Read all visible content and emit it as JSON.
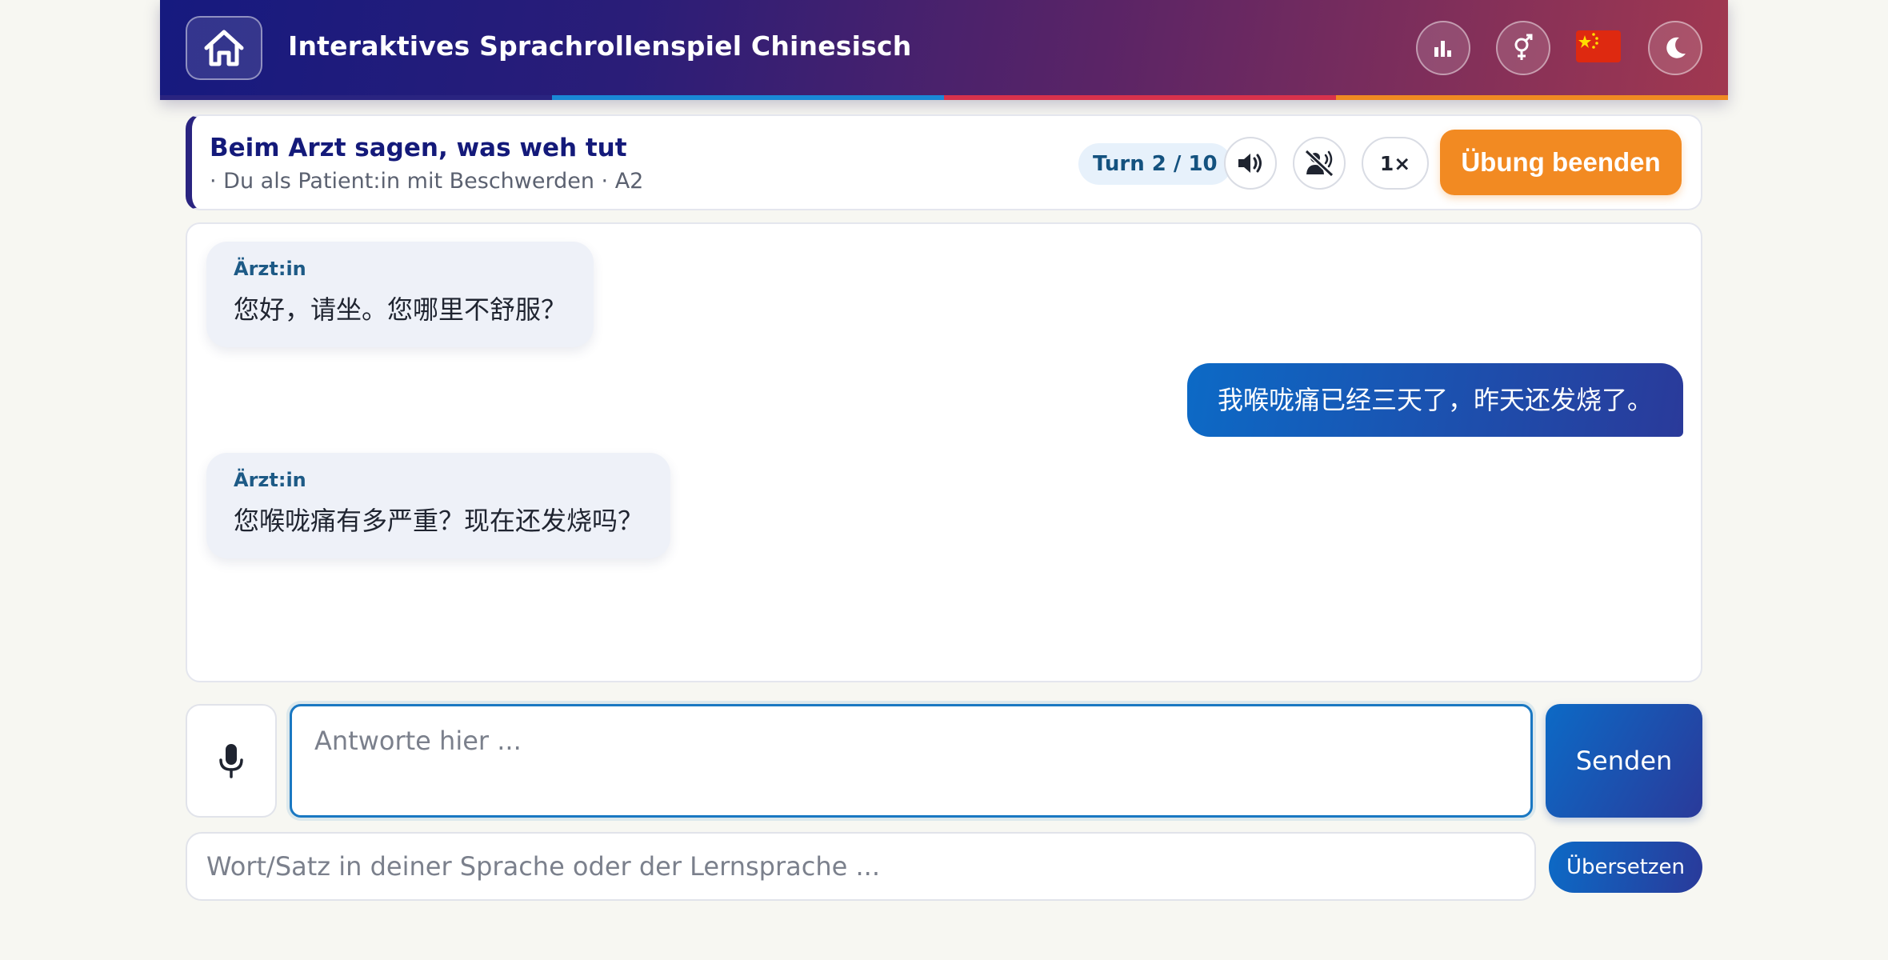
{
  "header": {
    "title": "Interaktives Sprachrollenspiel Chinesisch",
    "strip_colors": [
      "#2a2480",
      "#1a88d6",
      "#d8324c",
      "#f08a22"
    ]
  },
  "scenario": {
    "title": "Beim Arzt sagen, was weh tut",
    "subtitle": "· Du als Patient:in mit Beschwerden · A2",
    "turn": "Turn 2 / 10",
    "speed": "1×",
    "end_label": "Übung beenden"
  },
  "chat": {
    "messages": [
      {
        "role": "bot",
        "speaker": "Ärzt:in",
        "text": "您好，请坐。您哪里不舒服？"
      },
      {
        "role": "user",
        "text": "我喉咙痛已经三天了，昨天还发烧了。"
      },
      {
        "role": "bot",
        "speaker": "Ärzt:in",
        "text": "您喉咙痛有多严重？现在还发烧吗？"
      }
    ]
  },
  "input": {
    "placeholder": "Antworte hier ...",
    "send_label": "Senden"
  },
  "translate": {
    "placeholder": "Wort/Satz in deiner Sprache oder der Lernsprache ...",
    "button_label": "Übersetzen"
  },
  "icons": {
    "home": "home-icon",
    "stats": "bar-chart-icon",
    "gender": "gender-icon",
    "flag": "china-flag-icon",
    "theme": "moon-icon",
    "speaker": "speaker-icon",
    "mute": "mute-voice-icon",
    "mic": "microphone-icon"
  },
  "colors": {
    "accent_orange": "#f28a22",
    "accent_blue": "#0c6ac6",
    "navy": "#141a7a"
  }
}
